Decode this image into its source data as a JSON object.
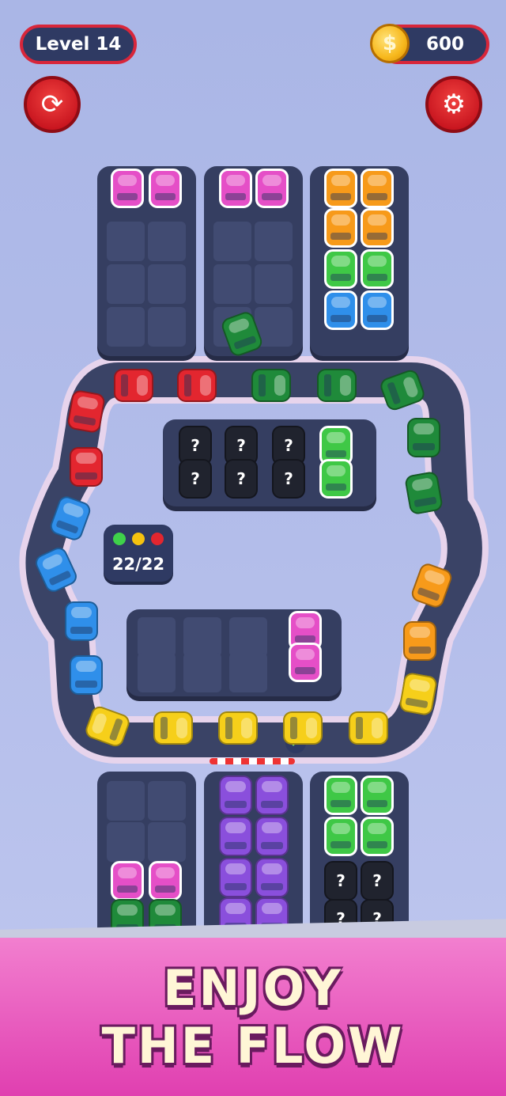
{
  "hud": {
    "level_label": "Level 14",
    "coin_symbol": "$",
    "coins": "600"
  },
  "buttons": {
    "restart_icon": "⟳",
    "settings_icon": "⚙"
  },
  "counter": {
    "text": "22/22"
  },
  "mystery_symbol": "?",
  "banner": {
    "line1": "ENJOY",
    "line2": "THE FLOW"
  },
  "colors": {
    "pink": "#e54fc7",
    "orange": "#f79a1a",
    "green": "#3fc846",
    "dark_green": "#1f8a3a",
    "blue": "#2f8fea",
    "red": "#e3262f",
    "yellow": "#f6cf1a",
    "purple": "#8a4fdc"
  }
}
